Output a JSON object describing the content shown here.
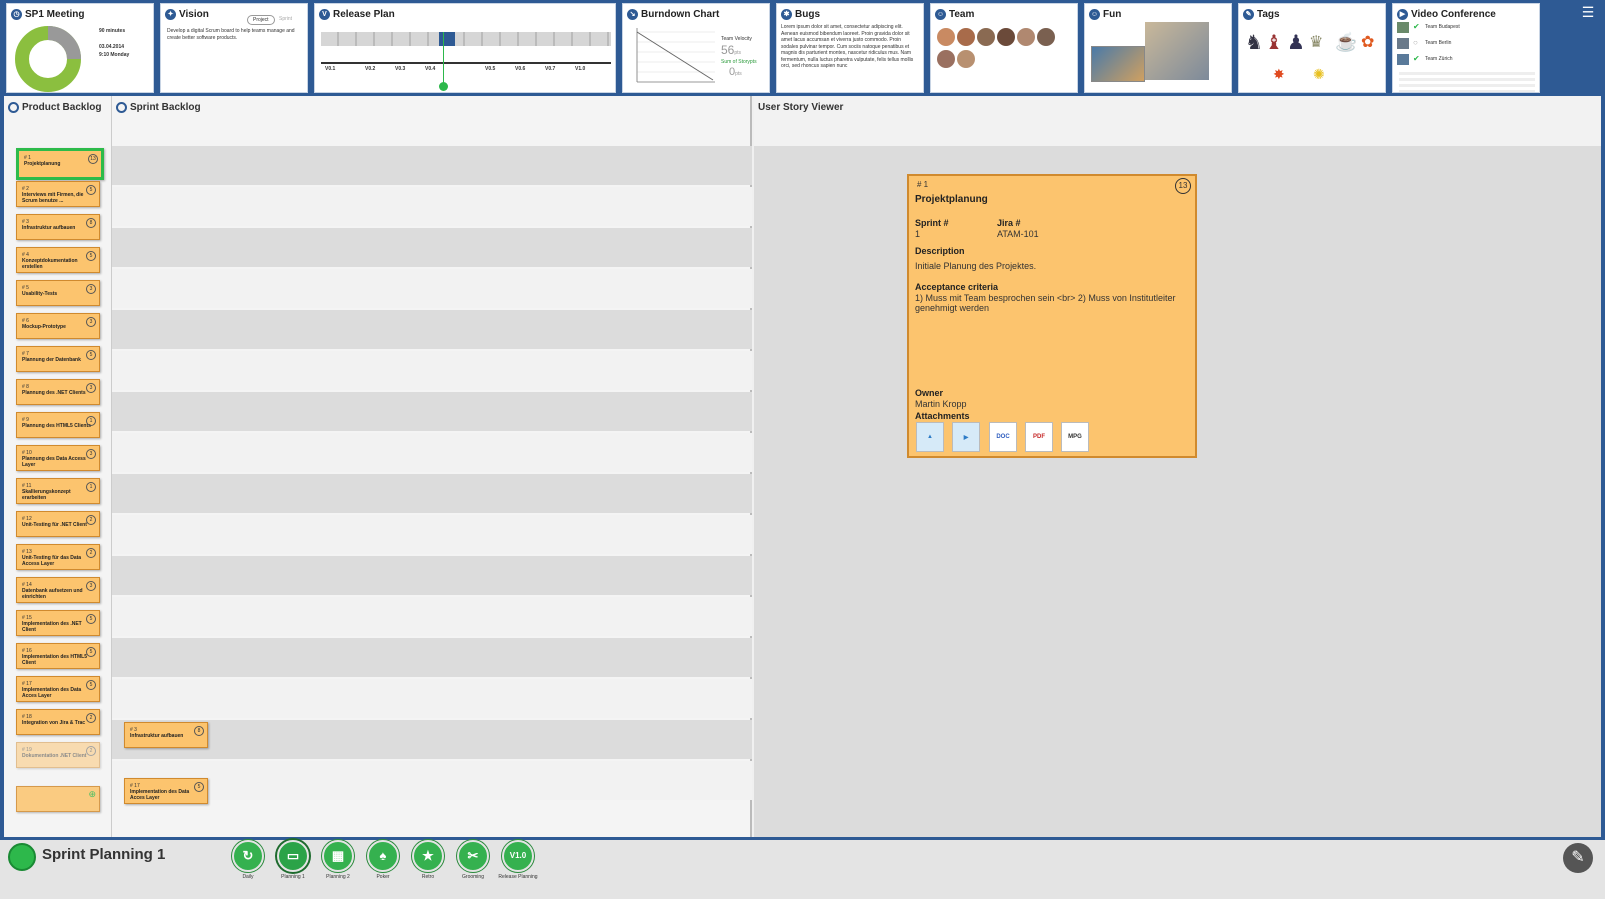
{
  "widgets": {
    "sp1": {
      "title": "SP1 Meeting",
      "duration": "90 minutes",
      "date": "03.04.2014",
      "time": "9:10 Monday"
    },
    "vision": {
      "title": "Vision",
      "tab_project": "Project",
      "tab_sprint": "Sprint",
      "text": "Develop a digital Scrum board to help teams manage and create better software products."
    },
    "release": {
      "title": "Release Plan",
      "versions": [
        "V0.1",
        "V0.2",
        "V0.3",
        "V0.4",
        "V0.5",
        "V0.6",
        "V0.7",
        "V1.0"
      ]
    },
    "burndown": {
      "title": "Burndown Chart",
      "velocity_label": "Team Velocity",
      "velocity_value": "56",
      "velocity_unit": "pts",
      "sum_label": "Sum of Storypts",
      "sum_value": "0",
      "sum_unit": "pts"
    },
    "bugs": {
      "title": "Bugs",
      "text": "Lorem ipsum dolor sit amet, consectetur adipiscing elit. Aenean euismod bibendum laoreet. Proin gravida dolor sit amet lacus accumsan et viverra justo commodo. Proin sodales pulvinar tempor. Cum sociis natoque penatibus et magnis dis parturient montes, nascetur ridiculus mus. Nam fermentum, nulla luctus pharetra vulputate, felis tellus mollis orci, sed rhoncus sapien nunc"
    },
    "team": {
      "title": "Team"
    },
    "fun": {
      "title": "Fun"
    },
    "tags": {
      "title": "Tags"
    },
    "video": {
      "title": "Video Conference",
      "entries": [
        "Team Budapest",
        "Team Berlin",
        "Team Zürich"
      ]
    }
  },
  "panels": {
    "product_backlog": "Product Backlog",
    "sprint_backlog": "Sprint Backlog",
    "user_story_viewer": "User Story Viewer"
  },
  "backlog": [
    {
      "id": "# 1",
      "title": "Projektplanung",
      "pts": "13"
    },
    {
      "id": "# 2",
      "title": "Interviews mit Firmen, die Scrum benutze ...",
      "pts": "5"
    },
    {
      "id": "# 3",
      "title": "Infrastruktur aufbauen",
      "pts": "8"
    },
    {
      "id": "# 4",
      "title": "Konzeptdokumentation erstellen",
      "pts": "5"
    },
    {
      "id": "# 5",
      "title": "Usability-Tests",
      "pts": "3"
    },
    {
      "id": "# 6",
      "title": "Mockup-Prototype",
      "pts": "3"
    },
    {
      "id": "# 7",
      "title": "Plannung der Datenbank",
      "pts": "5"
    },
    {
      "id": "# 8",
      "title": "Plannung des .NET Clients",
      "pts": "3"
    },
    {
      "id": "# 9",
      "title": "Plannung des HTML5 Clients",
      "pts": "1"
    },
    {
      "id": "# 10",
      "title": "Plannung des Data Access Layer",
      "pts": "3"
    },
    {
      "id": "# 11",
      "title": "Skallierungskonzept erarbeiten",
      "pts": "1"
    },
    {
      "id": "# 12",
      "title": "Unit-Testing für .NET Client",
      "pts": "2"
    },
    {
      "id": "# 13",
      "title": "Unit-Testing für das Data Access Layer",
      "pts": "2"
    },
    {
      "id": "# 14",
      "title": "Datenbank aufsetzen und einrichten",
      "pts": "3"
    },
    {
      "id": "# 15",
      "title": "Implementation des .NET Client",
      "pts": "5"
    },
    {
      "id": "# 16",
      "title": "Implementation des HTML5 Client",
      "pts": "5"
    },
    {
      "id": "# 17",
      "title": "Implementation des Data Acces Layer",
      "pts": "5"
    },
    {
      "id": "# 18",
      "title": "Integration von Jira & Trac",
      "pts": "2"
    },
    {
      "id": "# 19",
      "title": "Dokumentation .NET Client",
      "pts": "2"
    }
  ],
  "sprint_cards": [
    {
      "id": "# 3",
      "title": "Infrastruktur aufbauen",
      "pts": "8"
    },
    {
      "id": "# 17",
      "title": "Implementation des Data Acces Layer",
      "pts": "5"
    }
  ],
  "story": {
    "id": "# 1",
    "title": "Projektplanung",
    "pts": "13",
    "sprint_label": "Sprint #",
    "sprint_value": "1",
    "jira_label": "Jira #",
    "jira_value": "ATAM-101",
    "description_label": "Description",
    "description": "Initiale Planung des Projektes.",
    "acceptance_label": "Acceptance criteria",
    "acceptance": "1) Muss mit Team besprochen sein  <br> 2) Muss von Institutleiter genehmigt werden",
    "owner_label": "Owner",
    "owner": "Martin Kropp",
    "attachments_label": "Attachments",
    "attachments": [
      "image",
      "video",
      "DOC",
      "PDF",
      "MPG"
    ]
  },
  "bottom": {
    "app_title": "Sprint Planning 1",
    "nav": [
      "Daily",
      "Planning 1",
      "Planning 2",
      "Poker",
      "Retro",
      "Grooming",
      "Release Planning"
    ],
    "release_badge": "V1.0"
  },
  "colors": {
    "card": "#fcc46e",
    "accent": "#2e5a94",
    "selected": "#2dbb4a",
    "nav": "#35b14f"
  }
}
